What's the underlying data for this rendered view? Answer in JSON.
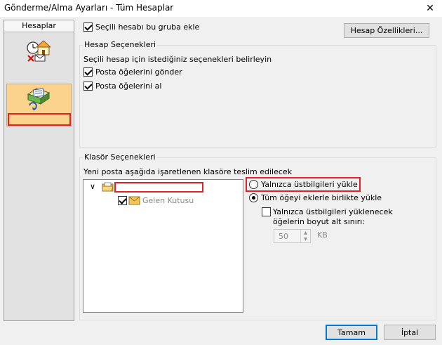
{
  "window": {
    "title": "Gönderme/Alma Ayarları - Tüm Hesaplar",
    "close_glyph": "✕"
  },
  "sidebar": {
    "header": "Hesaplar"
  },
  "account": {
    "include_in_group_label": "Seçili hesabı bu gruba ekle",
    "include_in_group_checked": true,
    "properties_button": "Hesap Özellikleri..."
  },
  "account_options": {
    "legend": "Hesap Seçenekleri",
    "description": "Seçili hesap için istediğiniz seçenekleri belirleyin",
    "send_label": "Posta öğelerini gönder",
    "send_checked": true,
    "receive_label": "Posta öğelerini al",
    "receive_checked": true
  },
  "folder_options": {
    "legend": "Klasör Seçenekleri",
    "description": "Yeni posta aşağıda işaretlenen klasöre teslim edilecek",
    "tree_chevron": "∨",
    "inbox_label": "Gelen Kutusu",
    "headers_only_label": "Yalnızca üstbilgileri yükle",
    "full_item_label": "Tüm öğeyi eklerle birlikte yükle",
    "limit_label_line1": "Yalnızca üstbilgileri yüklenecek",
    "limit_label_line2": "öğelerin boyut alt sınırı:",
    "size_value": "50",
    "size_unit": "KB"
  },
  "footer": {
    "ok_button": "Tamam",
    "cancel_button": "İptal"
  },
  "colors": {
    "highlight_red": "#e0202a",
    "selected_item_bg": "#fbd38c",
    "default_button_border": "#0078d7"
  }
}
